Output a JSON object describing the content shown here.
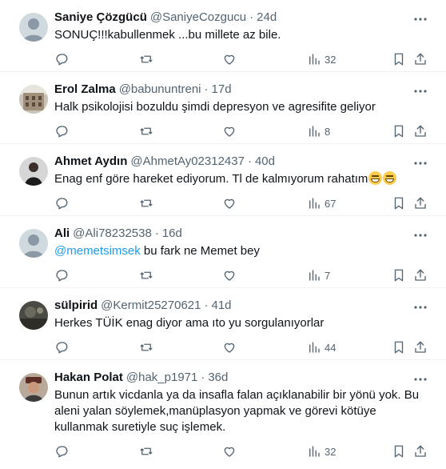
{
  "tweets": [
    {
      "name": "Saniye Çözgücü",
      "handle": "@SaniyeCozgucu",
      "time": "24d",
      "text": "SONUÇ!!!kabullenmek ...bu millete az bile.",
      "views": "32",
      "avatar": "default-avatar"
    },
    {
      "name": "Erol Zalma",
      "handle": "@babununtreni",
      "time": "17d",
      "text": "Halk psikolojisi bozuldu şimdi depresyon ve agresifite geliyor",
      "views": "8",
      "avatar": "building-avatar"
    },
    {
      "name": "Ahmet Aydın",
      "handle": "@AhmetAy02312437",
      "time": "40d",
      "text": "Enag enf göre hareket ediyorum. Tl de kalmıyorum rahatım",
      "emoji": [
        "grinning-face-emoji",
        "grinning-face-emoji"
      ],
      "views": "67",
      "avatar": "person-avatar"
    },
    {
      "name": "Ali",
      "handle": "@Ali78232538",
      "time": "16d",
      "mention": "@memetsimsek",
      "text": " bu fark ne Memet bey",
      "views": "7",
      "avatar": "default-avatar"
    },
    {
      "name": "sülpirid",
      "handle": "@Kermit25270621",
      "time": "41d",
      "text": "Herkes TÜİK enag diyor ama ıto yu sorgulanıyorlar",
      "views": "44",
      "avatar": "dark-avatar"
    },
    {
      "name": "Hakan Polat",
      "handle": "@hak_p1971",
      "time": "36d",
      "text": "Bunun artık vicdanla ya da insafla falan açıklanabilir bir yönü yok. Bu aleni yalan söylemek,manüplasyon yapmak ve görevi kötüye kullanmak suretiyle suç işlemek.",
      "views": "32",
      "avatar": "hat-avatar"
    }
  ],
  "colors": {
    "text": "#0f1419",
    "secondary": "#536471",
    "link": "#1d9bf0",
    "divider": "#eff3f4"
  },
  "dot": "·"
}
